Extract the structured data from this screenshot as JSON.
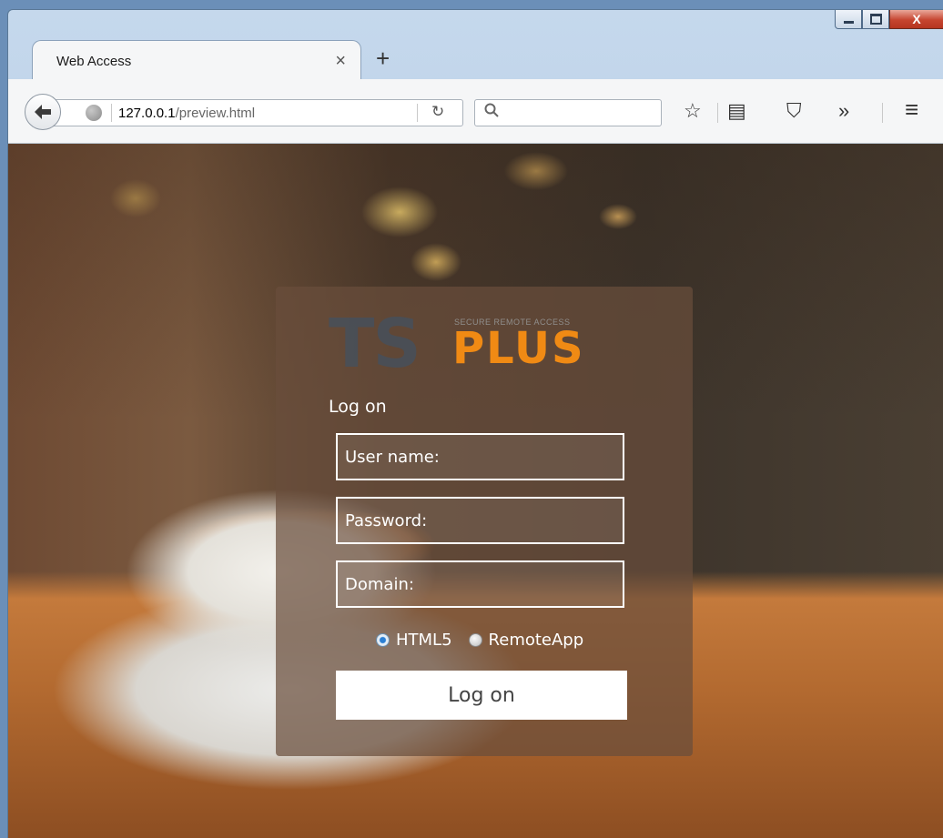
{
  "window": {
    "controls": {
      "minimize_icon": "minimize-icon",
      "maximize_icon": "maximize-icon",
      "close_label": "X"
    }
  },
  "browser": {
    "tab": {
      "title": "Web Access",
      "close_glyph": "×"
    },
    "new_tab_glyph": "+",
    "url": {
      "host": "127.0.0.1",
      "path": "/preview.html"
    },
    "reload_glyph": "↻",
    "search_glyph": "🔍",
    "toolbar_glyphs": {
      "bookmark": "☆",
      "reading_list": "▤",
      "pocket": "⛉",
      "overflow": "»",
      "menu": "≡"
    }
  },
  "login": {
    "logo": {
      "ts": "TS",
      "plus": "PLUS",
      "tagline": "SECURE REMOTE ACCESS"
    },
    "heading": "Log on",
    "username_placeholder": "User name:",
    "password_placeholder": "Password:",
    "domain_placeholder": "Domain:",
    "modes": [
      {
        "label": "HTML5",
        "checked": true
      },
      {
        "label": "RemoteApp",
        "checked": false
      }
    ],
    "submit_label": "Log on"
  },
  "colors": {
    "brand_orange": "#f08a14",
    "panel": "#694e3c"
  }
}
